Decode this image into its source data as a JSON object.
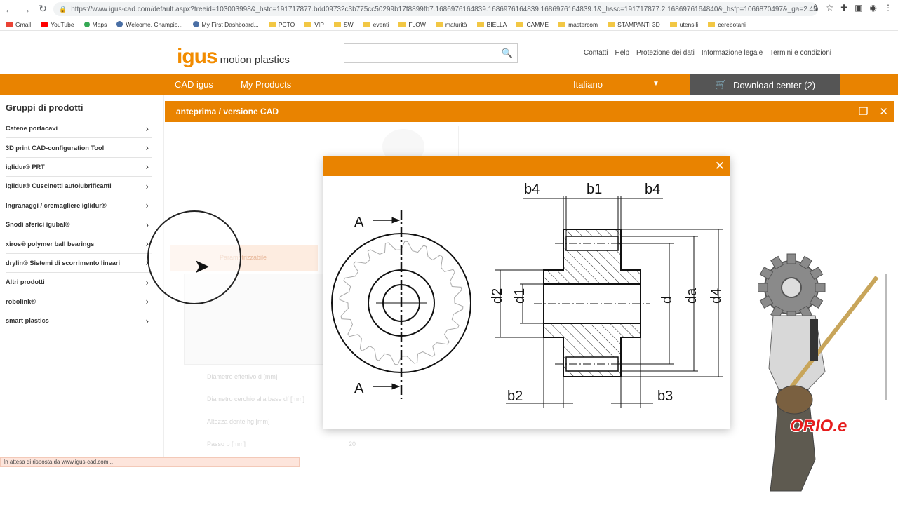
{
  "browser": {
    "url": "https://www.igus-cad.com/default.aspx?treeid=103003998&_hstc=191717877.bdd09732c3b775cc50299b17f8899fb7.1686976164839.1686976164839.1686976164839.1&_hssc=191717877.2.1686976164840&_hsfp=1066870497&_ga=2.45072483.61045...",
    "bookmarks": [
      "Gmail",
      "YouTube",
      "Maps",
      "Welcome, Champio...",
      "My First Dashboard...",
      "PCTO",
      "VIP",
      "SW",
      "eventi",
      "FLOW",
      "maturità",
      "BIELLA",
      "CAMME",
      "mastercom",
      "STAMPANTI 3D",
      "utensili",
      "cerebotani"
    ],
    "status": "In attesa di risposta da www.igus-cad.com..."
  },
  "header": {
    "logo_brand": "igus",
    "logo_tagline": "motion plastics",
    "search_placeholder": "",
    "links": [
      "Contatti",
      "Help",
      "Protezione dei dati",
      "Informazione legale",
      "Termini e condizioni"
    ]
  },
  "nav": {
    "cad_igus": "CAD igus",
    "my_products": "My Products",
    "language": "Italiano",
    "download_center": "Download center (2)"
  },
  "sidebar": {
    "title": "Gruppi di prodotti",
    "items": [
      "Catene portacavi",
      "3D print CAD-configuration Tool",
      "iglidur® PRT",
      "iglidur® Cuscinetti autolubrificanti",
      "Ingranaggi / cremagliere iglidur®",
      "Snodi sferici igubal®",
      "xiros® polymer ball bearings",
      "drylin® Sistemi di scorrimento lineari",
      "Altri prodotti",
      "robolink®",
      "smart plastics"
    ]
  },
  "cad_panel": {
    "title": "anteprima / versione CAD",
    "background_rows": [
      "Diametro effettivo d [mm]",
      "Diametro cerchio alla base df [mm]",
      "Altezza dente hg [mm]",
      "Passo p [mm]"
    ],
    "background_value": "20",
    "background_tab": "Parametrizzabile"
  },
  "drawing": {
    "section_label": "A",
    "dims": {
      "b1": "b1",
      "b2": "b2",
      "b3": "b3",
      "b4": "b4",
      "d": "d",
      "d1": "d1",
      "d2": "d2",
      "da": "da",
      "d4": "d4"
    }
  },
  "overlay": {
    "watermark": "ORIO.e"
  }
}
